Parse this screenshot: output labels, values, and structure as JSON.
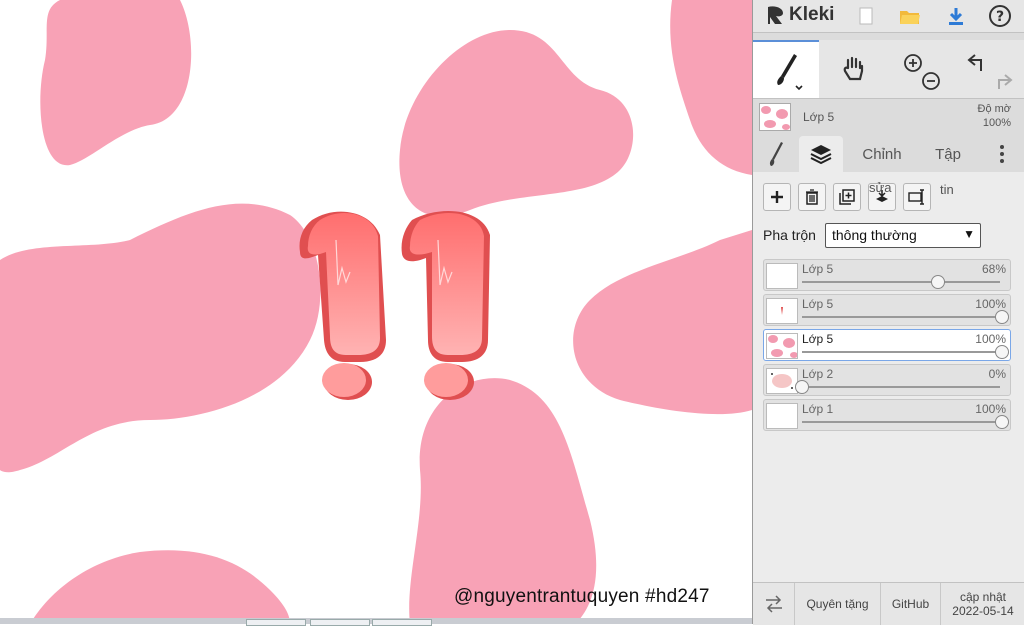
{
  "app": {
    "name": "Kleki"
  },
  "colors": {
    "pink": "#f8a2b6",
    "exclaim_dark": "#e04f50",
    "exclaim_light": "#ff9c9c",
    "accent": "#5b8fd8"
  },
  "topbar": {
    "icons": [
      "new-file-icon",
      "open-folder-icon",
      "download-icon",
      "help-icon"
    ]
  },
  "tools": [
    {
      "name": "brush",
      "icon": "brush-icon",
      "active": true
    },
    {
      "name": "hand",
      "icon": "hand-icon",
      "active": false
    },
    {
      "name": "zoom",
      "icon": "zoom-icon",
      "active": false
    },
    {
      "name": "undo-redo",
      "icon": "undo-icon",
      "active": false
    }
  ],
  "current_layer": {
    "name": "Lớp 5",
    "opacity_label": "Độ mờ",
    "opacity_value": "100%"
  },
  "tabs": [
    {
      "label": "",
      "icon": "brush-icon"
    },
    {
      "label": "",
      "icon": "layers-icon",
      "active": true
    },
    {
      "label": "Chỉnh"
    },
    {
      "label": "Tập"
    }
  ],
  "layer_actions": {
    "fuse_label": "sửa",
    "info_label": "tin"
  },
  "blend": {
    "label": "Pha trộn",
    "value": "thông thường"
  },
  "layers": [
    {
      "name": "Lớp 5",
      "opacity": "68%",
      "level": 0.68,
      "thumb": "checker",
      "selected": false
    },
    {
      "name": "Lớp 5",
      "opacity": "100%",
      "level": 1.0,
      "thumb": "checker-mark",
      "selected": false
    },
    {
      "name": "Lớp 5",
      "opacity": "100%",
      "level": 1.0,
      "thumb": "pink-spots",
      "selected": true
    },
    {
      "name": "Lớp 2",
      "opacity": "0%",
      "level": 0.0,
      "thumb": "blob",
      "selected": false
    },
    {
      "name": "Lớp 1",
      "opacity": "100%",
      "level": 1.0,
      "thumb": "white",
      "selected": false
    }
  ],
  "footer": {
    "donate": "Quyên tặng",
    "github": "GitHub",
    "update_line1": "cập nhật",
    "update_line2": "2022-05-14"
  },
  "watermark": "@nguyentrantuquyen  #hd247"
}
